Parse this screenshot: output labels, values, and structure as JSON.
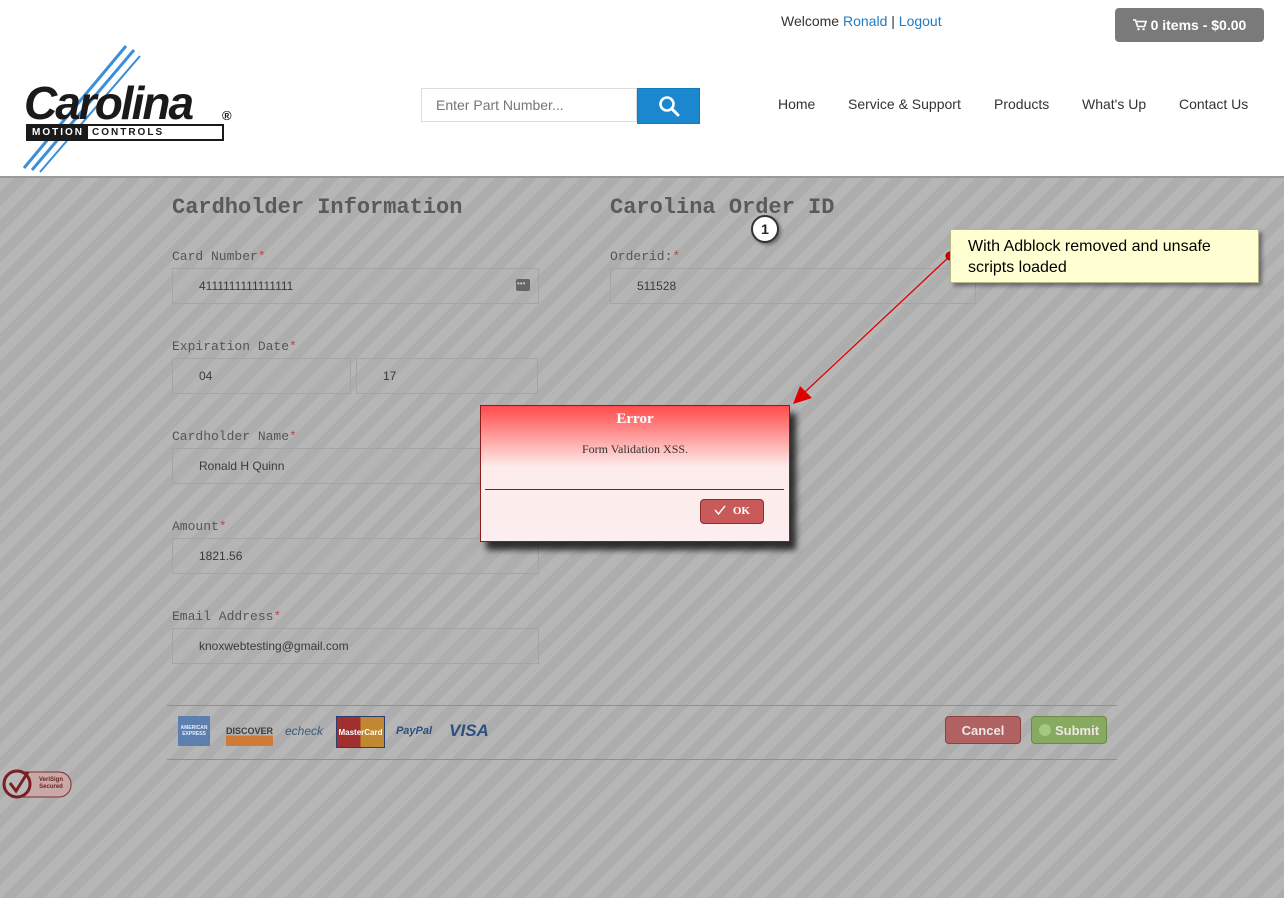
{
  "header": {
    "logo": {
      "word": "Carolina",
      "reg": "®",
      "sub_a": "MOTION",
      "sub_b": "CONTROLS"
    },
    "welcome_prefix": "Welcome",
    "user_name": "Ronald",
    "separator": "|",
    "logout": "Logout",
    "cart_label": "0 items - $0.00",
    "search_placeholder": "Enter Part Number...",
    "nav": [
      "Home",
      "Service & Support",
      "Products",
      "What's Up",
      "Contact Us"
    ]
  },
  "form": {
    "cardholder_title": "Cardholder Information",
    "order_title": "Carolina Order ID",
    "required_marker": "*",
    "card_number_label": "Card Number",
    "card_number": "4111111111111111",
    "order_id_label": "Orderid:",
    "order_id": "511528",
    "exp_label": "Expiration Date",
    "exp_month": "04",
    "exp_year": "17",
    "name_label": "Cardholder Name",
    "name": "Ronald H Quinn",
    "amount_label": "Amount",
    "amount": "1821.56",
    "email_label": "Email Address",
    "email": "knoxwebtesting@gmail.com",
    "payment_logos": [
      "AMERICAN EXPRESS",
      "DISCOVER",
      "echeck",
      "MasterCard",
      "PayPal",
      "VISA"
    ],
    "cancel": "Cancel",
    "submit": "Submit",
    "verisign": "VeriSign Secured"
  },
  "dialog": {
    "title": "Error",
    "message": "Form Validation XSS.",
    "ok": "OK"
  },
  "annotation": {
    "step": "1",
    "callout": "With Adblock removed and unsafe scripts loaded"
  },
  "colors": {
    "link": "#1f7bc4",
    "search_button": "#1a87cf",
    "dialog_top": "#ff4b4b",
    "callout_bg": "#ffffd2",
    "arrow": "#e00000"
  }
}
